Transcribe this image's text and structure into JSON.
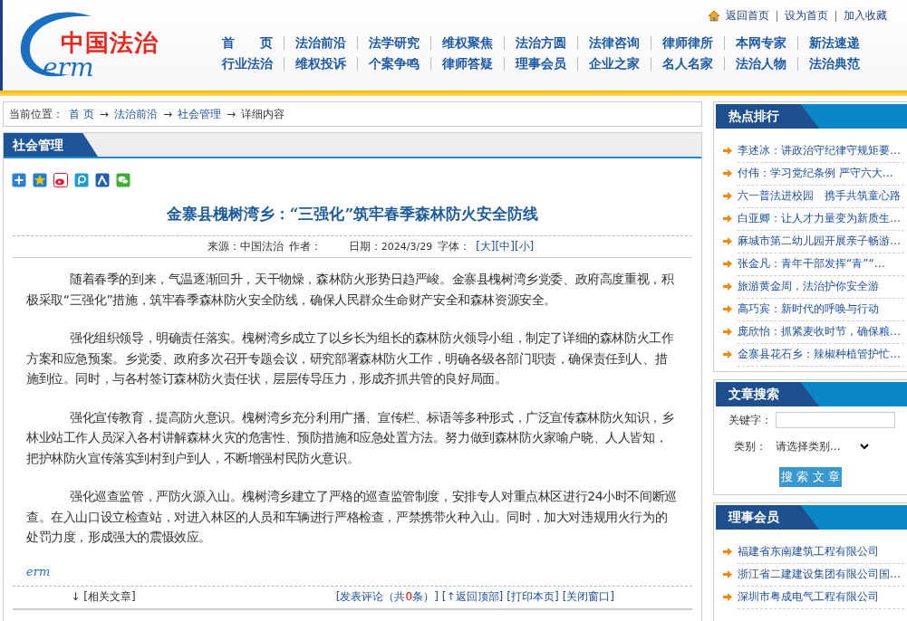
{
  "logo": {
    "name": "中国法治",
    "mark": "erm"
  },
  "top_links": [
    {
      "label": "返回首页",
      "icon": true
    },
    {
      "label": "设为首页",
      "icon": false
    },
    {
      "label": "加入收藏",
      "icon": false
    }
  ],
  "nav": [
    [
      "首　　页",
      "法治前沿",
      "法学研究",
      "维权聚焦",
      "法治方圆",
      "法律咨询",
      "律师律所",
      "本网专家",
      "新法速递"
    ],
    [
      "行业法治",
      "维权投诉",
      "个案争鸣",
      "律师答疑",
      "理事会员",
      "企业之家",
      "名人名家",
      "法治人物",
      "法治典范"
    ]
  ],
  "breadcrumb": {
    "label": "当前位置：",
    "separator": "→",
    "items": [
      {
        "text": "首 页",
        "link": true
      },
      {
        "text": "法治前沿",
        "link": true
      },
      {
        "text": "社会管理",
        "link": true
      },
      {
        "text": "详细内容",
        "link": false
      }
    ]
  },
  "section_title": "社会管理",
  "share_icons": [
    {
      "kind": "plus"
    },
    {
      "kind": "qzone"
    },
    {
      "kind": "weibo"
    },
    {
      "kind": "pengyou"
    },
    {
      "kind": "renren"
    },
    {
      "kind": "wechat"
    }
  ],
  "article": {
    "title": "金寨县槐树湾乡：“三强化”筑牢春季森林防火安全防线",
    "meta": {
      "source_label": "来源：",
      "source": "中国法治",
      "author_label": "作者：",
      "date_label": "日期：",
      "date": "2024/3/29",
      "size_label": "字体：",
      "sizes": [
        "[大]",
        "[中]",
        "[小]"
      ]
    },
    "paragraphs": [
      "随着春季的到来，气温逐渐回升，天干物燥，森林防火形势日趋严峻。金寨县槐树湾乡党委、政府高度重视，积极采取“三强化”措施，筑牢春季森林防火安全防线，确保人民群众生命财产安全和森林资源安全。",
      "强化组织领导，明确责任落实。槐树湾乡成立了以乡长为组长的森林防火领导小组，制定了详细的森林防火工作方案和应急预案。乡党委、政府多次召开专题会议，研究部署森林防火工作，明确各级各部门职责，确保责任到人、措施到位。同时，与各村签订森林防火责任状，层层传导压力，形成齐抓共管的良好局面。",
      "强化宣传教育，提高防火意识。槐树湾乡充分利用广播、宣传栏、标语等多种形式，广泛宣传森林防火知识，乡林业站工作人员深入各村讲解森林火灾的危害性、预防措施和应急处置方法。努力做到森林防火家喻户晓、人人皆知，把护林防火宣传落实到村到户到人，不断增强村民防火意识。",
      "强化巡查监管，严防火源入山。槐树湾乡建立了严格的巡查监管制度，安排专人对重点林区进行24小时不间断巡查。在入山口设立检查站，对进入林区的人员和车辆进行严格检查，严禁携带火种入山。同时，加大对违规用火行为的处罚力度，形成强大的震慑效应。"
    ],
    "end_mark": "erm"
  },
  "footer": {
    "arrow": "↓",
    "related": "[相关文章]",
    "comment_prefix": "[发表评论（共",
    "comment_count": "0",
    "comment_suffix": "条）]",
    "back_top": "[↑返回顶部]",
    "print": "[打印本页]",
    "close": "[关闭窗口]"
  },
  "hot": {
    "title": "热点排行",
    "items": [
      "李述冰：讲政治守纪律守规矩要…",
      "付伟：学习党纪条例 严守六大…",
      "六一普法进校园　携手共筑童心路",
      "白亚卿：让人才力量变为新质生…",
      "麻城市第二幼儿园开展亲子畅游…",
      "张金凡：青年干部发挥“青”“…",
      "旅游黄金周，法治护你安全游",
      "高巧宾：新时代的呼唤与行动",
      "庞欣怡：抓紧麦收时节，确保粮…",
      "金寨县花石乡：辣椒种植管护忙…"
    ]
  },
  "search": {
    "title": "文章搜索",
    "keyword_label": "关键字：",
    "category_label": "类别：",
    "category_value": "请选择类别...",
    "button": "搜 索 文 章"
  },
  "members": {
    "title": "理事会员",
    "items": [
      "福建省东南建筑工程有限公司",
      "浙江省二建建设集团有限公司国…",
      "深圳市粤成电气工程有限公司"
    ]
  }
}
